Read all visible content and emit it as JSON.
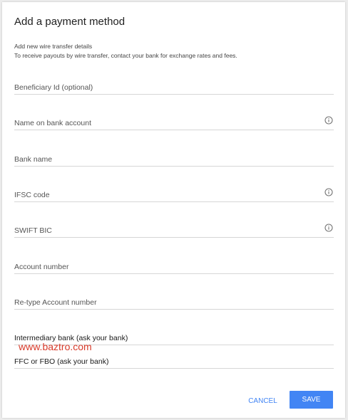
{
  "dialog": {
    "title": "Add a payment method",
    "subtitle": "Add new wire transfer details",
    "description": "To receive payouts by wire transfer, contact your bank for exchange rates and fees."
  },
  "fields": {
    "beneficiary_id": {
      "placeholder": "Beneficiary Id (optional)",
      "value": ""
    },
    "name_on_account": {
      "placeholder": "Name on bank account",
      "value": "",
      "icon": "info-icon"
    },
    "bank_name": {
      "placeholder": "Bank name",
      "value": ""
    },
    "ifsc_code": {
      "placeholder": "IFSC code",
      "value": "",
      "icon": "info-icon"
    },
    "swift_bic": {
      "placeholder": "SWIFT BIC",
      "value": "",
      "icon": "info-icon"
    },
    "account_number": {
      "placeholder": "Account number",
      "value": ""
    },
    "retype_account_number": {
      "placeholder": "Re-type Account number",
      "value": ""
    },
    "intermediary_bank": {
      "placeholder": "Intermediary bank (ask your bank)",
      "value": ""
    },
    "ffc_or_fbo": {
      "placeholder": "FFC or FBO (ask your bank)",
      "value": ""
    }
  },
  "watermark": "www.baztro.com",
  "actions": {
    "cancel_label": "CANCEL",
    "save_label": "SAVE"
  },
  "colors": {
    "accent": "#4285f4",
    "watermark": "#d83a2a"
  }
}
